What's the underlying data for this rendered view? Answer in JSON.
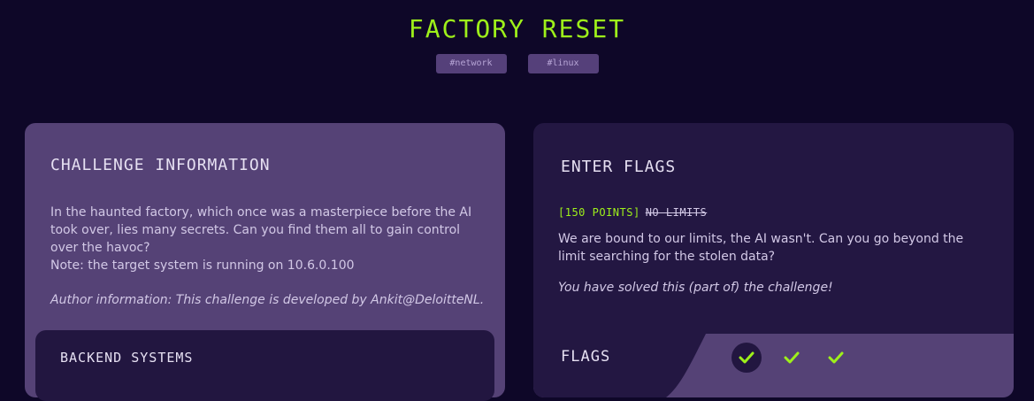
{
  "header": {
    "title": "FACTORY RESET",
    "tags": [
      "#network",
      "#linux"
    ]
  },
  "challenge": {
    "heading": "CHALLENGE INFORMATION",
    "description_line1": "In the haunted factory, which once was a masterpiece before the AI took over, lies many secrets. Can you find them all to gain control over the havoc?",
    "description_line2": "Note: the target system is running on 10.6.0.100",
    "author": "Author information: This challenge is developed by Ankit@DeloitteNL."
  },
  "backend": {
    "heading": "BACKEND SYSTEMS"
  },
  "flags_panel": {
    "heading": "ENTER FLAGS",
    "points_label": "[150 POINTS]",
    "flag_name": "NO LIMITS",
    "description": "We are bound to our limits, the AI wasn't. Can you go beyond the limit searching for the stolen data?",
    "solved_text": "You have solved this (part of) the challenge!",
    "flags_label": "FLAGS",
    "flag_checks": [
      {
        "icon": "check-icon",
        "state": "selected"
      },
      {
        "icon": "check-icon",
        "state": "solved"
      },
      {
        "icon": "check-icon",
        "state": "solved"
      }
    ]
  },
  "colors": {
    "background": "#0e0728",
    "accent": "#9ef01a",
    "card_purple": "#554276",
    "card_dark": "#231742"
  }
}
